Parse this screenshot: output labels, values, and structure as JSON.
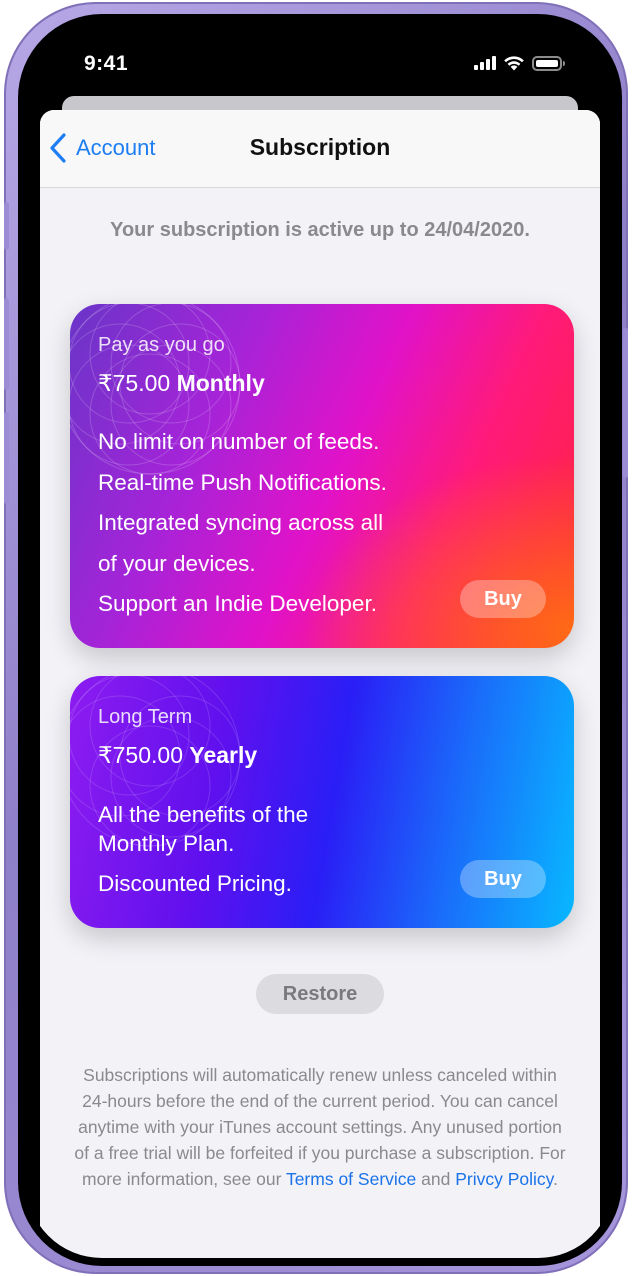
{
  "status_bar": {
    "time": "9:41"
  },
  "nav": {
    "back_label": "Account",
    "title": "Subscription"
  },
  "subscription_note": "Your subscription is active up to 24/04/2020.",
  "plans": [
    {
      "label": "Pay as you go",
      "price": "₹75.00",
      "period": "Monthly",
      "features": [
        "No limit on number of feeds.",
        "Real-time Push Notifications.",
        "Integrated syncing across all",
        "of your devices.",
        "Support an Indie Developer."
      ],
      "buy_label": "Buy"
    },
    {
      "label": "Long Term",
      "price": "₹750.00",
      "period": "Yearly",
      "features": [
        "All the benefits of the",
        "Monthly Plan.",
        "Discounted Pricing."
      ],
      "buy_label": "Buy"
    }
  ],
  "restore_label": "Restore",
  "legal": {
    "text": "Subscriptions will automatically renew unless canceled within 24-hours before the end of the current period. You can cancel anytime with your iTunes account settings. Any unused portion of a free trial will be forfeited if you purchase a subscription. For more information, see our",
    "terms_link": "Terms of Service",
    "and": "and",
    "privacy_link": "Privcy Policy",
    "end": "."
  },
  "colors": {
    "accent": "#1c7ef2",
    "background": "#f2f2f7",
    "device_frame": "#a696dc"
  },
  "icons": {
    "back": "chevron-left-icon",
    "signal": "cellular-signal-icon",
    "wifi": "wifi-icon",
    "battery": "battery-icon"
  }
}
